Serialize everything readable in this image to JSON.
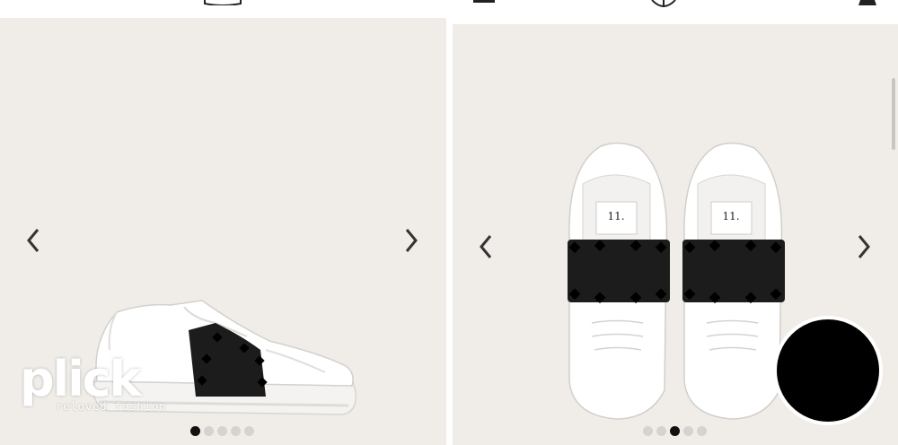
{
  "left_panel": {
    "carousel": {
      "slide_count": 5,
      "active_index": 0
    },
    "image_alt": "White sneaker with black studded band, side view"
  },
  "right_panel": {
    "carousel": {
      "slide_count": 5,
      "active_index": 2
    },
    "image_alt": "Pair of white sneakers with black studded band, top view",
    "tongue_label": "11."
  },
  "watermark": {
    "brand": "plick",
    "tagline": "reloved fashion"
  },
  "icons": {
    "prev": "chevron-left-icon",
    "next": "chevron-right-icon",
    "fab": "circle-action-icon"
  },
  "colors": {
    "stage_background": "#f0ede8",
    "dot_active": "#111111",
    "dot_inactive": "#d6d3ce",
    "band": "#1c1c1c"
  }
}
